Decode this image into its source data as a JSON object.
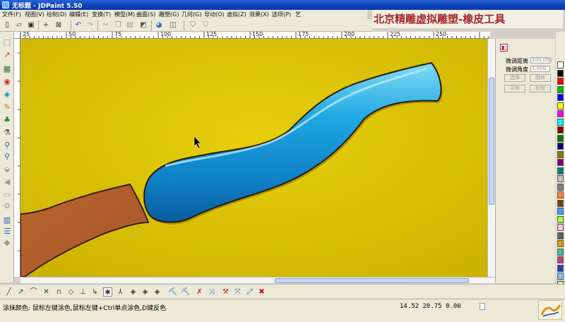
{
  "window": {
    "title": "无标题 - JDPaint 5.50"
  },
  "menu": [
    "文件(F)",
    "视图(V)",
    "绘制(D)",
    "编辑(E)",
    "变换(T)",
    "模型(M)",
    "曲面(S)",
    "雕塑(G)",
    "几何(G)",
    "导动(O)",
    "虚拟(Z)",
    "效果(X)",
    "选项(P)",
    "艺"
  ],
  "watermark": "北京精雕虚拟雕塑-橡皮工具",
  "ruler": {
    "labels": [
      "25",
      "50",
      "75",
      "100",
      "125",
      "150",
      "175",
      "200",
      "225",
      "250"
    ]
  },
  "right_panel": {
    "fields": [
      {
        "label": "微调距离",
        "value": "100.000"
      },
      {
        "label": "微调角度",
        "value": "1.000"
      }
    ],
    "buttons": [
      "选择",
      "跳转",
      "平移",
      "拾取"
    ]
  },
  "palette_colors": [
    "#ffffff",
    "#000000",
    "#ff0000",
    "#00c000",
    "#0000ff",
    "#ffff00",
    "#ff00ff",
    "#00ffff",
    "#800000",
    "#008000",
    "#000080",
    "#808000",
    "#800080",
    "#008080",
    "#c0c0c0",
    "#808080",
    "#ff8040",
    "#804000",
    "#40a0ff",
    "#a0ff40",
    "#ffc0e0",
    "#606060",
    "#e0a000",
    "#40c0a0",
    "#c04080",
    "#2040c0",
    "#80c0ff",
    "#ffe080",
    "#a0a0ff",
    "#004040",
    "#ff6060"
  ],
  "status": {
    "hint": "涂抹颜色: 鼠标左键涂色,鼠标左键+Ctrl单点涂色,D键反色",
    "coords": "14.52  20.75  0.00"
  },
  "icons": {
    "toolbar": [
      "new-icon",
      "open-icon",
      "save-icon",
      "crosshair-icon",
      "zoom-box-icon",
      "undo-icon",
      "redo-icon",
      "cut-icon",
      "copy-icon",
      "paste-icon",
      "render-icon",
      "view-icon",
      "shield-icon",
      "shield-outline-icon"
    ],
    "left": [
      "select-icon",
      "node-edit-icon",
      "layer-icon",
      "sphere-icon",
      "paint-bucket-icon",
      "brush-icon",
      "sculpt-icon",
      "flask-icon",
      "pin-icon",
      "drop-icon",
      "eraser-icon",
      "arrow-left-icon",
      "ruler-icon",
      "slice-icon",
      "grid-icon",
      "settings-icon"
    ],
    "bottom": [
      "line-icon",
      "polyline-icon",
      "arc-icon",
      "cross-icon",
      "curve-icon",
      "diamond-icon",
      "perpendicular-icon",
      "tangent-icon",
      "snap-icon",
      "node-icon",
      "diamond-a-icon",
      "diamond-b-icon",
      "diamond-c-icon",
      "brush-a-icon",
      "brush-b-icon",
      "cross-a-icon",
      "cross-b-icon",
      "tool-a-icon",
      "tool-b-icon",
      "tool-c-icon",
      "delete-icon"
    ]
  }
}
